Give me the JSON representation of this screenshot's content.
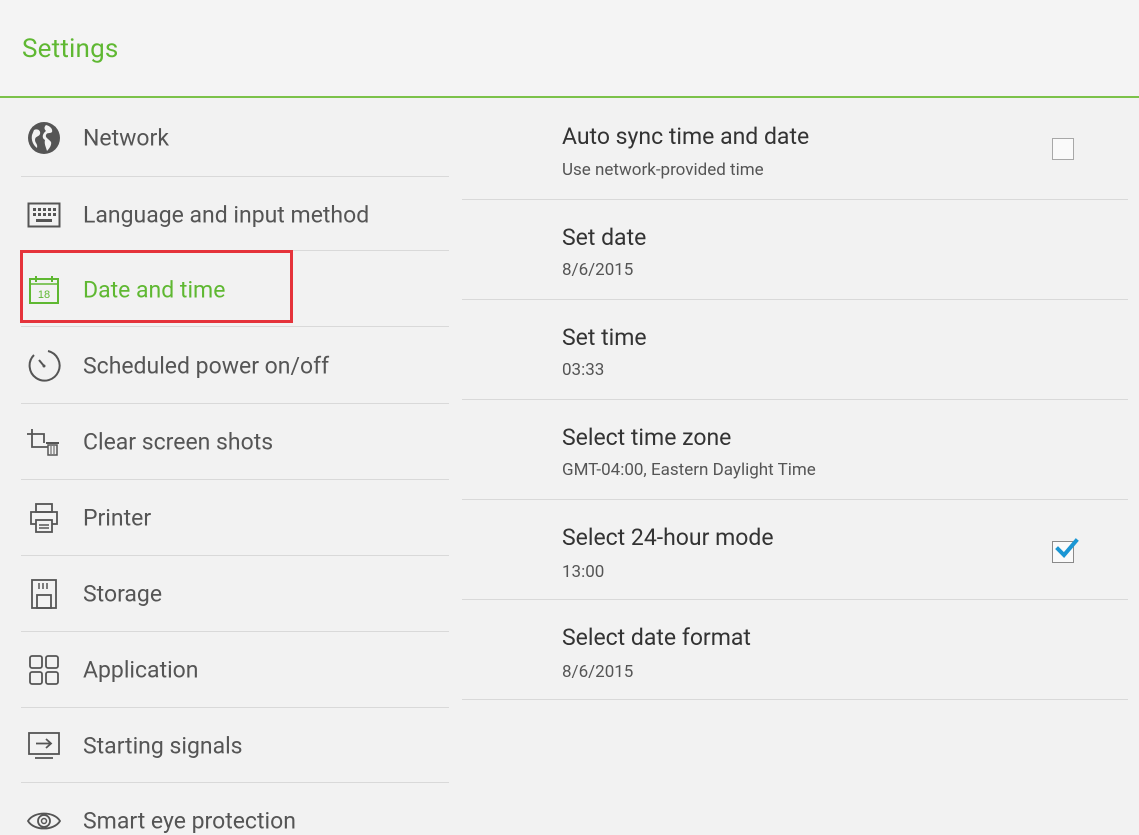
{
  "header": {
    "title": "Settings"
  },
  "colors": {
    "accent": "#5fb832",
    "highlight": "#e5333b",
    "check": "#1a96d4"
  },
  "sidebar": {
    "items": [
      {
        "label": "Network",
        "icon": "globe-icon"
      },
      {
        "label": "Language and input method",
        "icon": "keyboard-icon"
      },
      {
        "label": "Date and time",
        "icon": "calendar-icon",
        "active": true,
        "icon_text": "18"
      },
      {
        "label": "Scheduled power on/off",
        "icon": "timer-icon"
      },
      {
        "label": "Clear screen shots",
        "icon": "crop-trash-icon"
      },
      {
        "label": "Printer",
        "icon": "printer-icon"
      },
      {
        "label": "Storage",
        "icon": "sd-card-icon"
      },
      {
        "label": "Application",
        "icon": "apps-grid-icon"
      },
      {
        "label": "Starting signals",
        "icon": "input-source-icon"
      },
      {
        "label": "Smart eye protection",
        "icon": "eye-icon"
      }
    ]
  },
  "settings": [
    {
      "title": "Auto sync time and date",
      "subtitle": "Use network-provided time",
      "checkbox": false
    },
    {
      "title": "Set date",
      "subtitle": "8/6/2015"
    },
    {
      "title": "Set time",
      "subtitle": "03:33"
    },
    {
      "title": "Select time zone",
      "subtitle": "GMT-04:00, Eastern Daylight Time"
    },
    {
      "title": "Select 24-hour mode",
      "subtitle": "13:00",
      "checkbox": true
    },
    {
      "title": "Select date format",
      "subtitle": "8/6/2015"
    }
  ]
}
